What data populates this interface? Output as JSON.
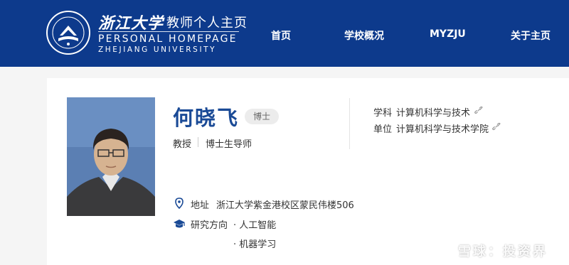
{
  "header": {
    "brand_cn": "浙江大学",
    "brand_suffix": "教师个人主页",
    "brand_en_line1": "PERSONAL HOMEPAGE",
    "brand_en_line2": "ZHEJIANG UNIVERSITY",
    "nav": [
      "首页",
      "学校概况",
      "MYZJU",
      "关于主页"
    ]
  },
  "profile": {
    "name": "何晓飞",
    "degree_badge": "博士",
    "title": "教授",
    "role": "博士生导师",
    "discipline_label": "学科",
    "discipline_value": "计算机科学与技术",
    "unit_label": "单位",
    "unit_value": "计算机科学与技术学院",
    "address_label": "地址",
    "address_value": "浙江大学紫金港校区蒙民伟楼506",
    "research_label": "研究方向",
    "research_areas": [
      "人工智能",
      "机器学习"
    ]
  },
  "watermark": {
    "text": "雪球：投资界"
  },
  "colors": {
    "header_bg": "#0d3a8c",
    "name_blue": "#1a4a96",
    "icon_blue": "#1a4a96"
  }
}
